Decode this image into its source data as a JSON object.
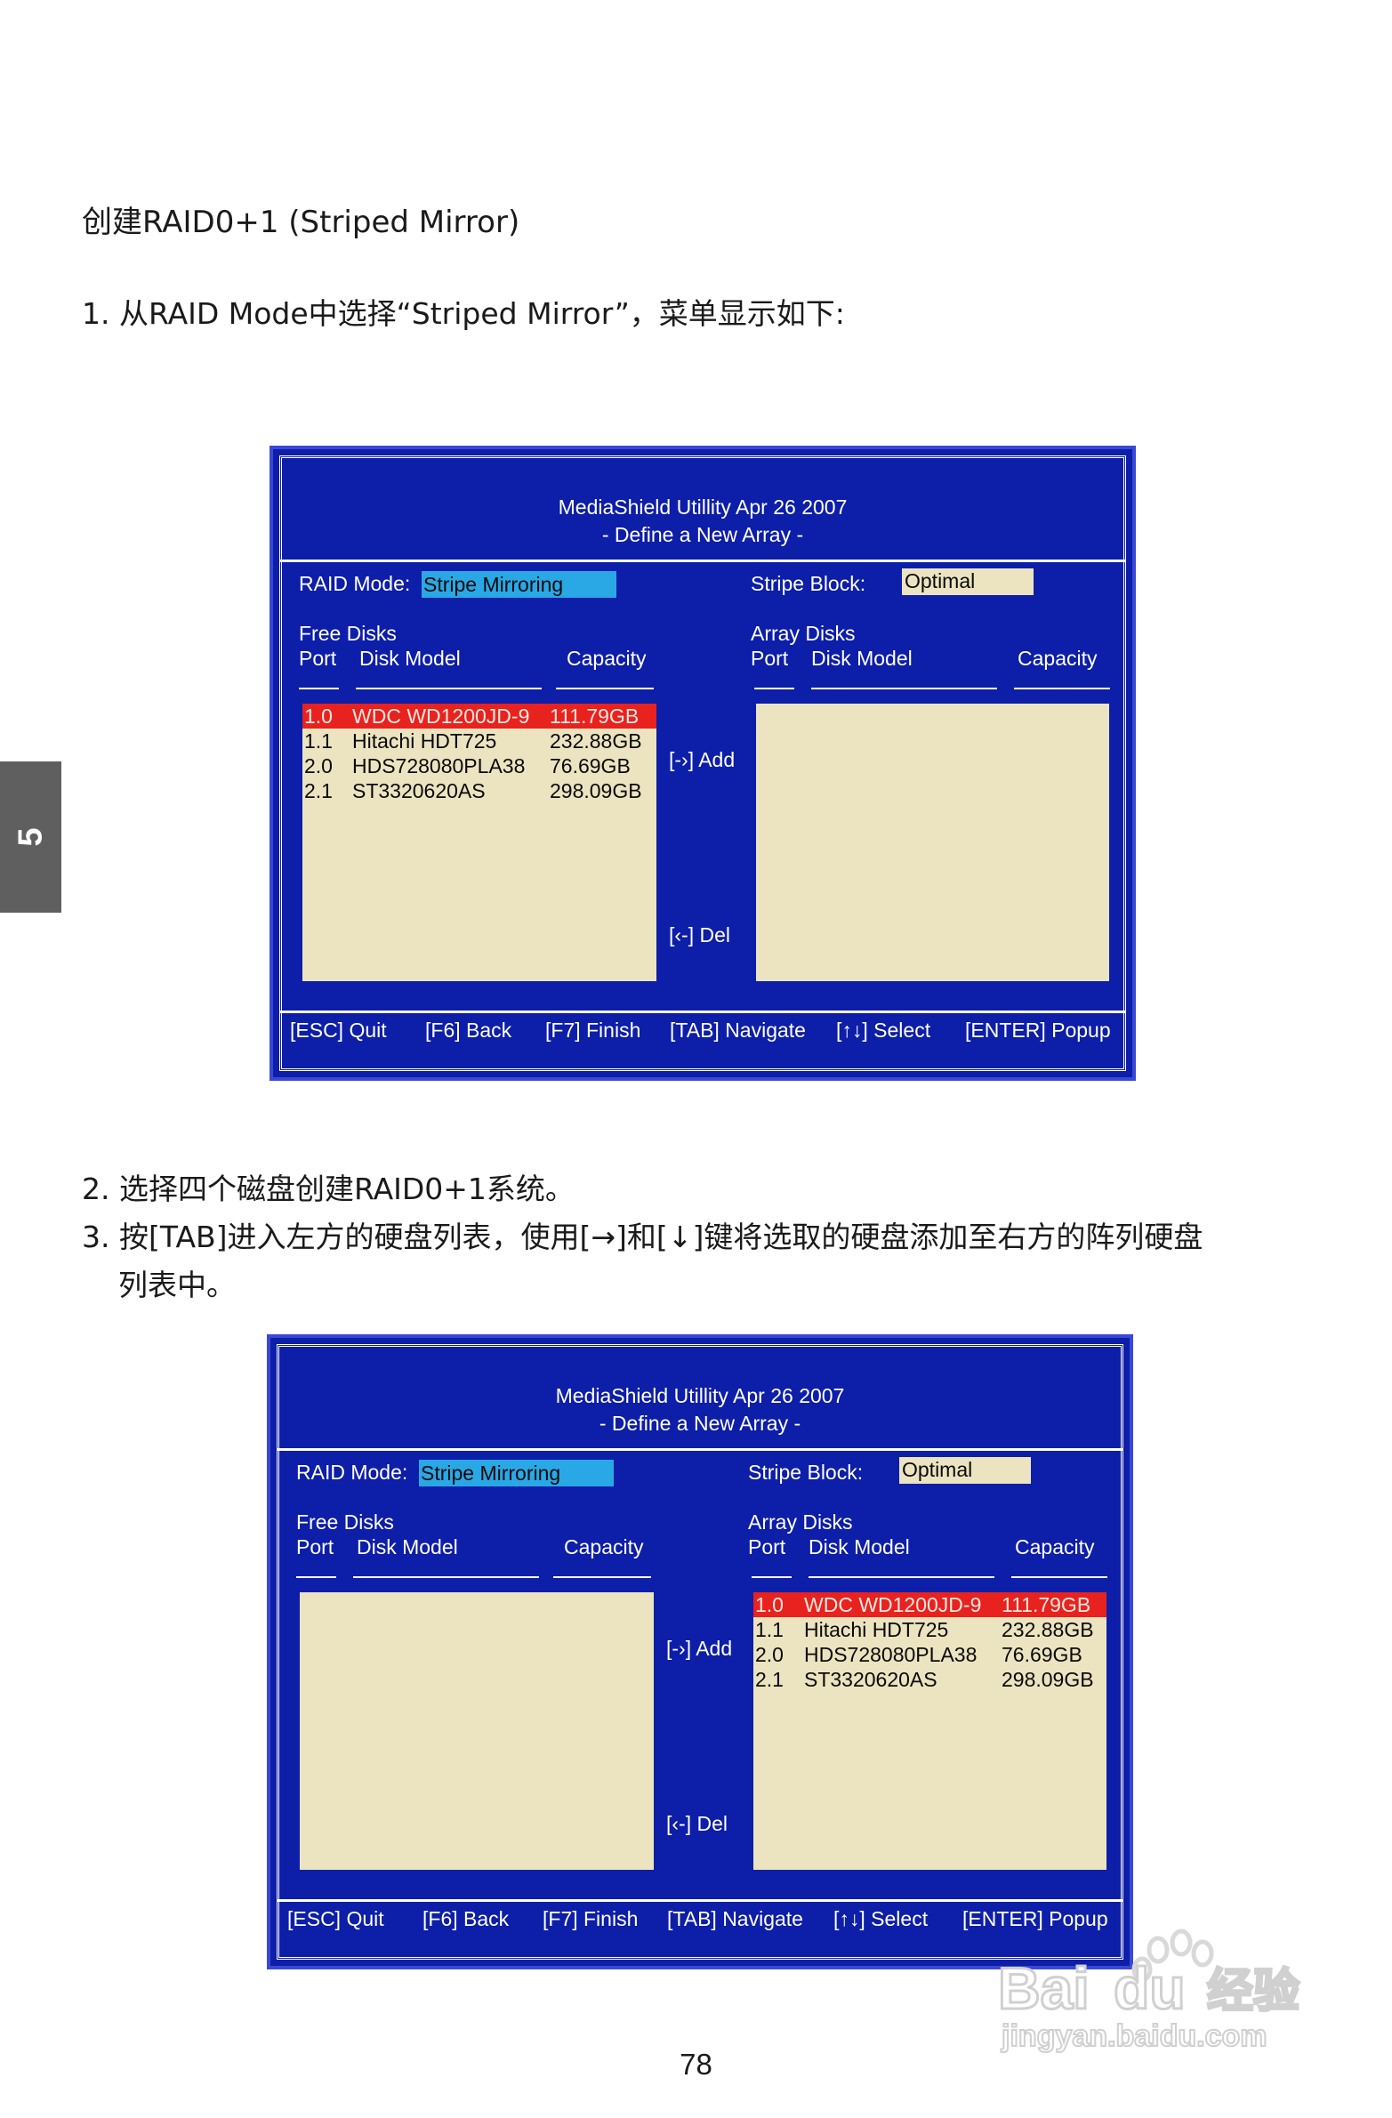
{
  "heading": "创建RAID0+1 (Striped Mirror)",
  "step1": "1.  从RAID Mode中选择“Striped Mirror”，菜单显示如下:",
  "step2": "2. 选择四个磁盘创建RAID0+1系统。",
  "step3_line1": "3.  按[TAB]进入左方的硬盘列表，使用[→]和[↓]键将选取的硬盘添加至右方的阵列硬盘",
  "step3_line2": "列表中。",
  "side_tab": "5",
  "page_number": "78",
  "bios": {
    "title": "MediaShield Utillity   Apr 26 2007",
    "subtitle": "- Define a New Array -",
    "raid_mode_label": "RAID Mode:",
    "raid_mode_value": "Stripe Mirroring",
    "stripe_block_label": "Stripe Block:",
    "stripe_block_value": "Optimal",
    "free_disks_label": "Free Disks",
    "array_disks_label": "Array Disks",
    "col_port": "Port",
    "col_model": "Disk Model",
    "col_capacity": "Capacity",
    "add_label": "[-›] Add",
    "del_label": "[‹-] Del",
    "footer": [
      "[ESC] Quit",
      "[F6] Back",
      "[F7] Finish",
      "[TAB] Navigate",
      "[↑↓] Select",
      "[ENTER] Popup"
    ]
  },
  "disks": [
    {
      "port": "1.0",
      "model": "WDC WD1200JD-9",
      "capacity": "111.79GB"
    },
    {
      "port": "1.1",
      "model": "Hitachi HDT725",
      "capacity": "232.88GB"
    },
    {
      "port": "2.0",
      "model": "HDS728080PLA38",
      "capacity": "76.69GB"
    },
    {
      "port": "2.1",
      "model": "ST3320620AS",
      "capacity": "298.09GB"
    }
  ],
  "colors": {
    "screen_blue": "#0d1ea8",
    "list_bg": "#ece4c0",
    "selected_row": "#e8221e",
    "mode_highlight": "#2aa8e6"
  },
  "watermark": {
    "brand": "Bai",
    "brand2": "du",
    "cn": "经验",
    "url": "jingyan.baidu.com"
  }
}
